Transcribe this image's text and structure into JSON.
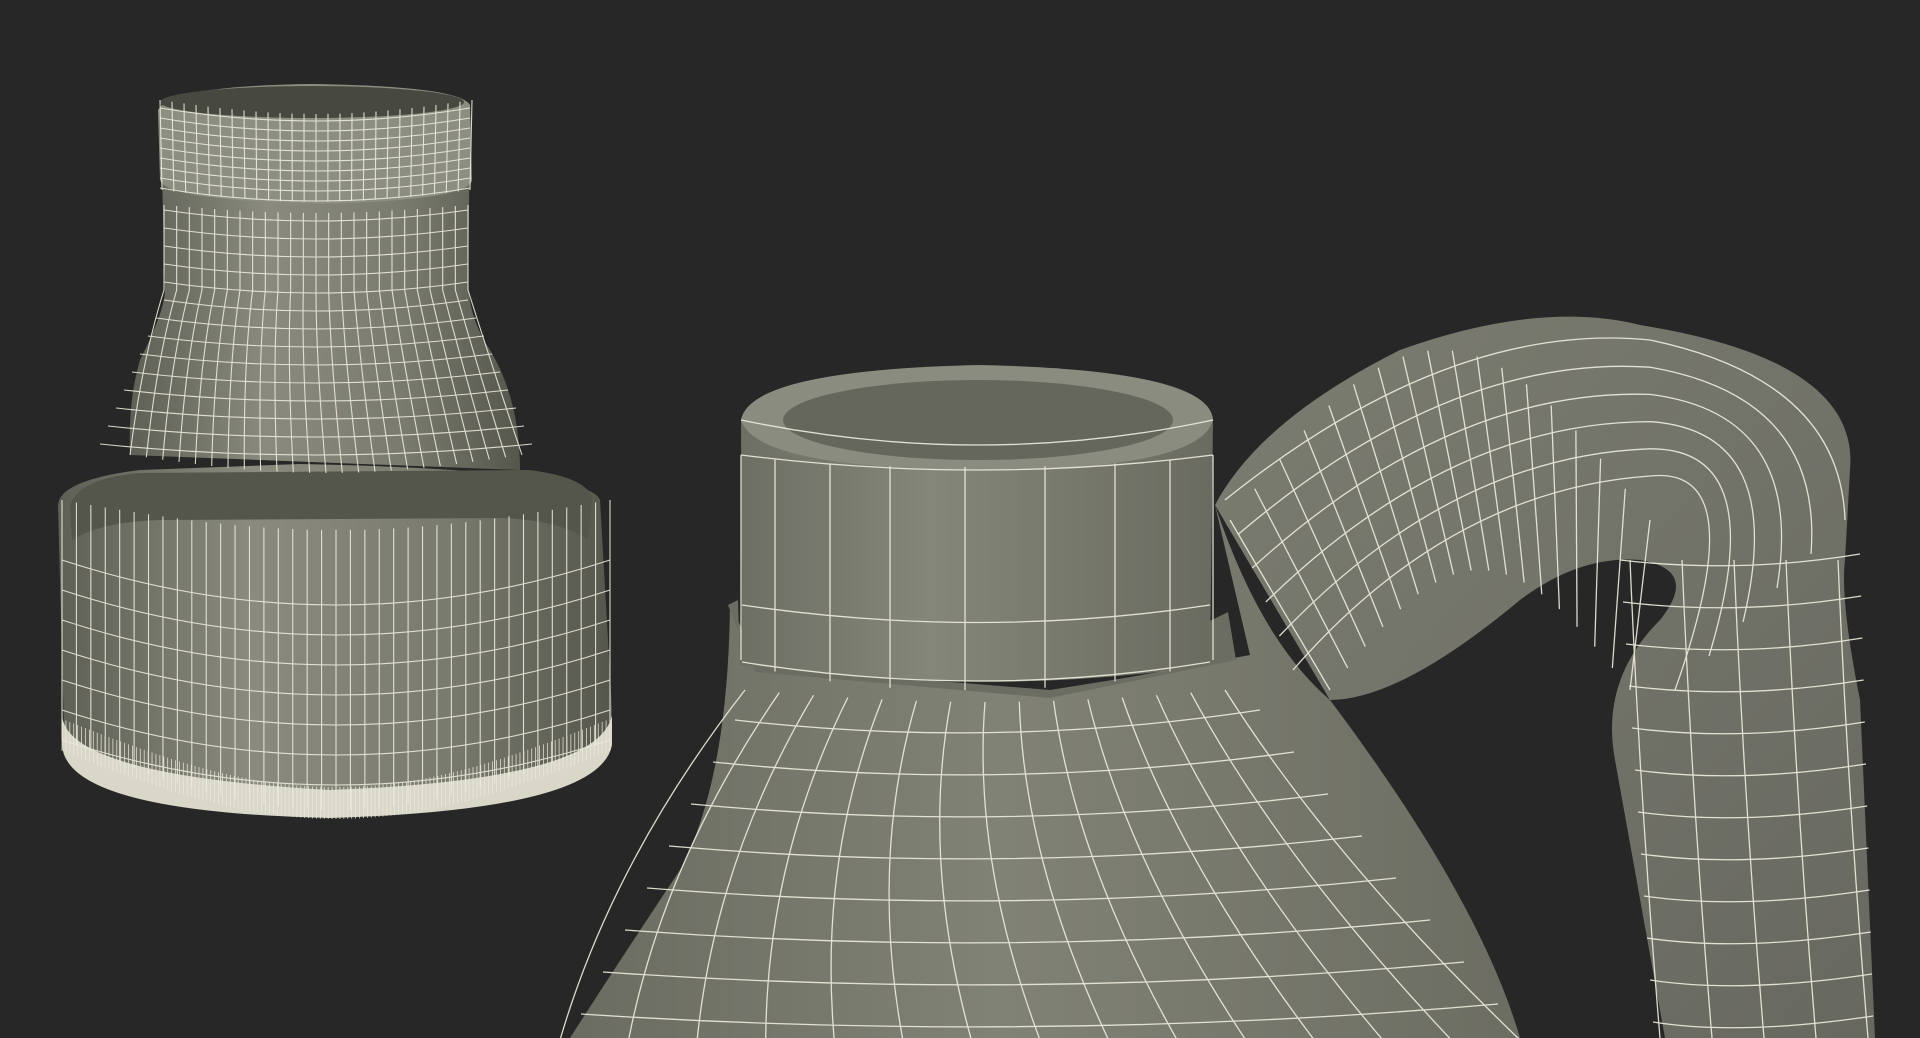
{
  "scene": {
    "background_color": "#272727",
    "surface_color": "#75766a",
    "wire_color": "#eceadb",
    "objects": [
      {
        "name": "bottle-cap-wireframe"
      },
      {
        "name": "bottle-jug-wireframe"
      }
    ]
  }
}
